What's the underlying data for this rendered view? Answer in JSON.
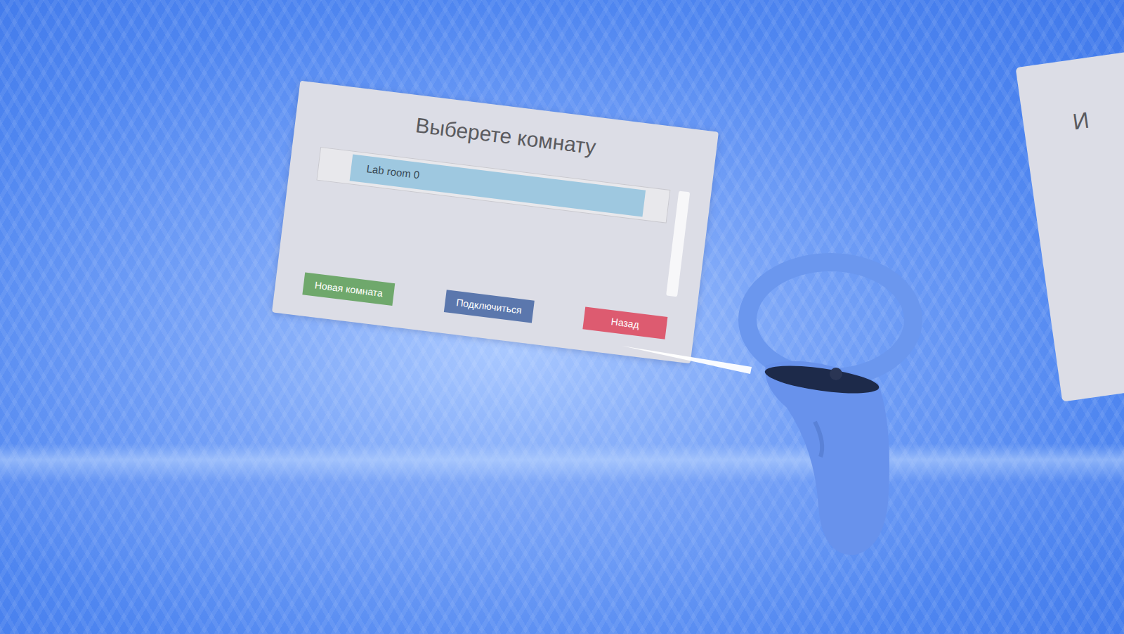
{
  "panel": {
    "title": "Выберете комнату"
  },
  "rooms": [
    {
      "label": "Lab room 0",
      "selected": true
    }
  ],
  "buttons": [
    {
      "label": "Новая комната",
      "color": "#6fa86c"
    },
    {
      "label": "Подключиться",
      "color": "#5b77ad"
    },
    {
      "label": "Назад",
      "color": "#dd5b70"
    }
  ],
  "side_panel": {
    "text": "И"
  }
}
